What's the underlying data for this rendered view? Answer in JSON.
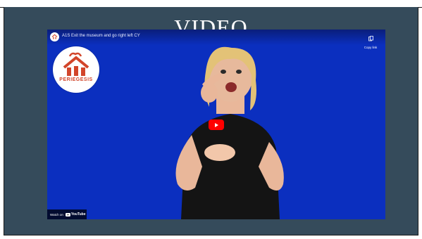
{
  "section": {
    "heading": "VIDEO"
  },
  "player": {
    "title": "A1S Exit the museum and go right left CY",
    "copy_link_label": "Copy link",
    "watch_on_label": "Watch on",
    "youtube_label": "YouTube",
    "play_icon": "play-icon",
    "accent_color": "#ff0000",
    "background_color": "#0b2fbf"
  },
  "logo": {
    "text": "PERIEGESIS",
    "color": "#d2452a"
  }
}
